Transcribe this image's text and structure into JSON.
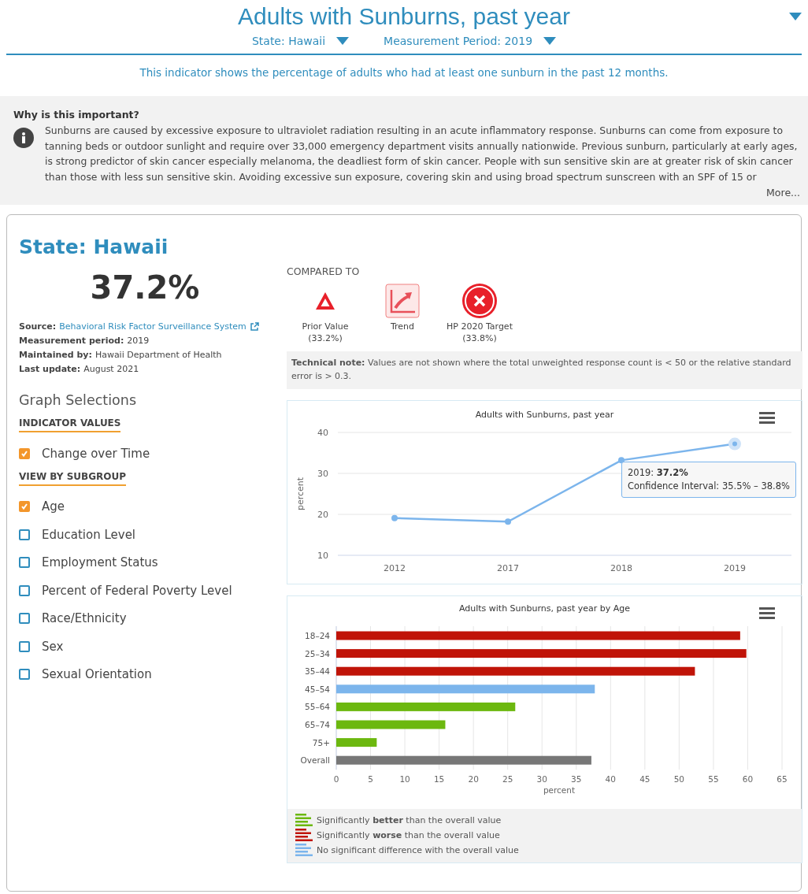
{
  "header": {
    "title": "Adults with Sunburns, past year",
    "filters": [
      {
        "label": "State: Hawaii"
      },
      {
        "label": "Measurement Period: 2019"
      }
    ],
    "description": "This indicator shows the percentage of adults who had at least one sunburn in the past 12 months."
  },
  "importance": {
    "heading": "Why is this important?",
    "text": "Sunburns are caused by excessive exposure to ultraviolet radiation  resulting in an acute inflammatory response. Sunburns can come from exposure to tanning beds or outdoor sunlight and require over 33,000 emergency department visits annually nationwide. Previous sunburn, particularly at early ages, is strong predictor of skin cancer especially melanoma, the deadliest form of skin cancer. People with sun sensitive skin are at greater risk of skin cancer than those with less sun sensitive skin. Avoiding excessive sun exposure, covering skin and using broad spectrum sunscreen with an SPF of 15 or",
    "more": "More..."
  },
  "summary": {
    "title": "State: Hawaii",
    "value": "37.2%",
    "details": [
      {
        "label": "Source:",
        "value": "Behavioral Risk Factor Surveillance System",
        "kind": "link"
      },
      {
        "label": "Measurement period:",
        "value": "2019",
        "kind": "text"
      },
      {
        "label": "Maintained by:",
        "value": "Hawaii Department of Health",
        "kind": "text"
      },
      {
        "label": "Last update:",
        "value": "August 2021",
        "kind": "text"
      }
    ]
  },
  "graph_selections": {
    "title": "Graph Selections",
    "groups": [
      {
        "heading": "INDICATOR VALUES",
        "options": [
          {
            "label": "Change over Time",
            "checked": true
          }
        ]
      },
      {
        "heading": "VIEW BY SUBGROUP",
        "options": [
          {
            "label": "Age",
            "checked": true
          },
          {
            "label": "Education Level",
            "checked": false
          },
          {
            "label": "Employment Status",
            "checked": false
          },
          {
            "label": "Percent of Federal Poverty Level",
            "checked": false
          },
          {
            "label": "Race/Ethnicity",
            "checked": false
          },
          {
            "label": "Sex",
            "checked": false
          },
          {
            "label": "Sexual Orientation",
            "checked": false
          }
        ]
      }
    ]
  },
  "compared_to": {
    "heading": "COMPARED TO",
    "items": [
      {
        "kind": "prior",
        "label": "Prior Value",
        "value": "(33.2%)"
      },
      {
        "kind": "trend",
        "label": "Trend"
      },
      {
        "kind": "target",
        "label": "HP 2020 Target",
        "value": "(33.8%)"
      }
    ]
  },
  "technical_note": "**Technical note:** Values are not shown where the total unweighted response count is < 50 or the relative standard error is > 0.3.",
  "line_chart": {
    "chart_data": {
      "type": "line",
      "title": "Adults with Sunburns, past year",
      "ylabel": "percent",
      "categories": [
        "2012",
        "2017",
        "2018",
        "2019"
      ],
      "series": [
        {
          "color": "#7cb5ec",
          "marker": "circle",
          "values": [
            19.1,
            18.2,
            33.2,
            37.2
          ]
        }
      ],
      "ylim": [
        10,
        40
      ],
      "yticks": [
        10,
        20,
        30,
        40
      ],
      "grid": true,
      "annotations": [
        "2019: **37.2%**",
        "Confidence Interval: 35.5% – 38.8%"
      ]
    },
    "points": [
      {
        "hovered": false
      },
      {
        "hovered": false
      },
      {
        "hovered": false
      },
      {
        "hovered": true
      }
    ]
  },
  "bar_chart": {
    "chart_data": {
      "type": "bar",
      "orientation": "horizontal",
      "title": "Adults with Sunburns, past year by Age",
      "xlabel": "percent",
      "categories": [
        "18–24",
        "25–34",
        "35–44",
        "45–54",
        "55–64",
        "65–74",
        "75+",
        "Overall"
      ],
      "series": [
        {
          "name": "Significantly **better** than the overall value",
          "color": "#6cb80f",
          "values": [
            null,
            null,
            null,
            null,
            26.1,
            15.9,
            5.9,
            null
          ]
        },
        {
          "name": "Significantly **worse** than the overall value",
          "color": "#c01408",
          "values": [
            58.9,
            59.8,
            52.3,
            null,
            null,
            null,
            null,
            null
          ]
        },
        {
          "name": "No significant difference with the overall value",
          "color": "#7cb5ec",
          "values": [
            null,
            null,
            null,
            37.7,
            null,
            null,
            null,
            null
          ]
        },
        {
          "color": "#777777",
          "values": [
            null,
            null,
            null,
            null,
            null,
            null,
            null,
            37.2
          ]
        }
      ],
      "xlim": [
        0,
        65
      ],
      "xticks": [
        0,
        5,
        10,
        15,
        20,
        25,
        30,
        35,
        40,
        45,
        50,
        55,
        60,
        65
      ],
      "grid": true,
      "legend": "bottom"
    }
  }
}
